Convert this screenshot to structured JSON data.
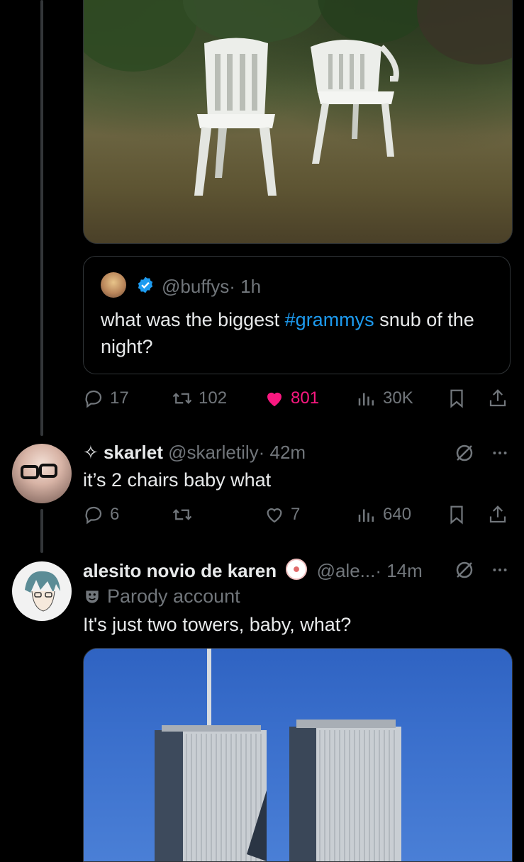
{
  "quoted_tweet": {
    "handle": "@buffys",
    "time": "· 1h",
    "text_before": "what was the biggest ",
    "hashtag": "#grammys",
    "text_after": " snub of the night?"
  },
  "main_actions": {
    "replies": "17",
    "reposts": "102",
    "likes": "801",
    "views": "30K",
    "like_color": "#f91880"
  },
  "reply1": {
    "name": "✧ skarlet",
    "handle": "@skarletily",
    "time": "· 42m",
    "text": "it’s 2 chairs baby what",
    "actions": {
      "replies": "6",
      "reposts": "",
      "likes": "7",
      "views": "640"
    }
  },
  "reply2": {
    "name": "alesito novio de karen",
    "handle": "@ale...",
    "time": "· 14m",
    "label": "Parody account",
    "text": "It's just two towers, baby, what?"
  },
  "colors": {
    "accent": "#1d9bf0",
    "muted": "#71767b",
    "background": "#000000",
    "border": "#2f3336"
  }
}
